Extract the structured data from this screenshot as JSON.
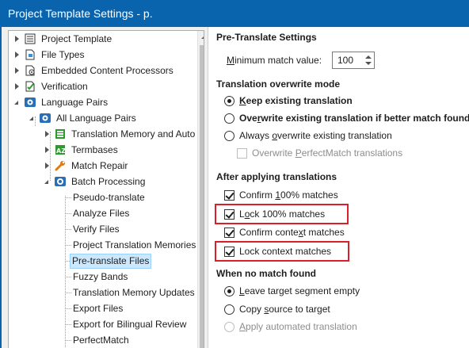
{
  "window": {
    "title": "Project Template Settings - p."
  },
  "tree": {
    "items": [
      {
        "label": "Project Template",
        "icon": "settings-list-icon"
      },
      {
        "label": "File Types",
        "icon": "file-types-icon"
      },
      {
        "label": "Embedded Content Processors",
        "icon": "embedded-content-icon"
      },
      {
        "label": "Verification",
        "icon": "verification-icon"
      },
      {
        "label": "Language Pairs",
        "icon": "language-pairs-icon"
      },
      {
        "label": "All Language Pairs",
        "icon": "language-pair-icon"
      },
      {
        "label": "Translation Memory and Auto",
        "icon": "translation-memory-icon"
      },
      {
        "label": "Termbases",
        "icon": "termbase-icon"
      },
      {
        "label": "Match Repair",
        "icon": "wrench-icon"
      },
      {
        "label": "Batch Processing",
        "icon": "batch-processing-icon"
      },
      {
        "label": "Pseudo-translate"
      },
      {
        "label": "Analyze Files"
      },
      {
        "label": "Verify Files"
      },
      {
        "label": "Project Translation Memories"
      },
      {
        "label": "Pre-translate Files",
        "selected": true
      },
      {
        "label": "Fuzzy Bands"
      },
      {
        "label": "Translation Memory Updates"
      },
      {
        "label": "Export Files"
      },
      {
        "label": "Export for Bilingual Review"
      },
      {
        "label": "PerfectMatch"
      }
    ]
  },
  "panel": {
    "title": "Pre-Translate Settings",
    "min_match": {
      "label_pre": "",
      "label_u": "M",
      "label_post": "inimum match value:",
      "value": "100"
    },
    "overwrite": {
      "heading": "Translation overwrite mode",
      "options": [
        {
          "u": "K",
          "rest": "eep existing translation",
          "checked": true,
          "bold": true
        },
        {
          "u": "",
          "pre": "Ove",
          "uchar": "r",
          "rest": "write existing translation if better match found",
          "checked": false,
          "bold": true
        },
        {
          "pre": "Always ",
          "uchar": "o",
          "rest": "verwrite existing translation",
          "checked": false,
          "bold": false
        }
      ],
      "perfectmatch": {
        "pre": "Overwrite ",
        "uchar": "P",
        "rest": "erfectMatch translations",
        "checked": false,
        "disabled": true
      }
    },
    "after": {
      "heading": "After applying translations",
      "options": [
        {
          "pre": "Confirm ",
          "uchar": "1",
          "rest": "00% matches",
          "checked": true
        },
        {
          "pre": "L",
          "uchar": "o",
          "rest": "ck 100% matches",
          "checked": true,
          "highlighted": true
        },
        {
          "pre": "Confirm conte",
          "uchar": "x",
          "rest": "t matches",
          "checked": true
        },
        {
          "pre": "Lock context matches",
          "uchar": "",
          "rest": "",
          "checked": true,
          "highlighted": true
        }
      ]
    },
    "nomatch": {
      "heading": "When no match found",
      "options": [
        {
          "pre": "",
          "uchar": "L",
          "rest": "eave target segment empty",
          "checked": true,
          "disabled": false
        },
        {
          "pre": "Copy ",
          "uchar": "s",
          "rest": "ource to target",
          "checked": false,
          "disabled": false
        },
        {
          "pre": "",
          "uchar": "A",
          "rest": "pply automated translation",
          "checked": false,
          "disabled": true
        }
      ]
    }
  },
  "colors": {
    "titlebar": "#0a64ad",
    "highlight_box": "#d9202a",
    "selection": "#cce8ff"
  }
}
